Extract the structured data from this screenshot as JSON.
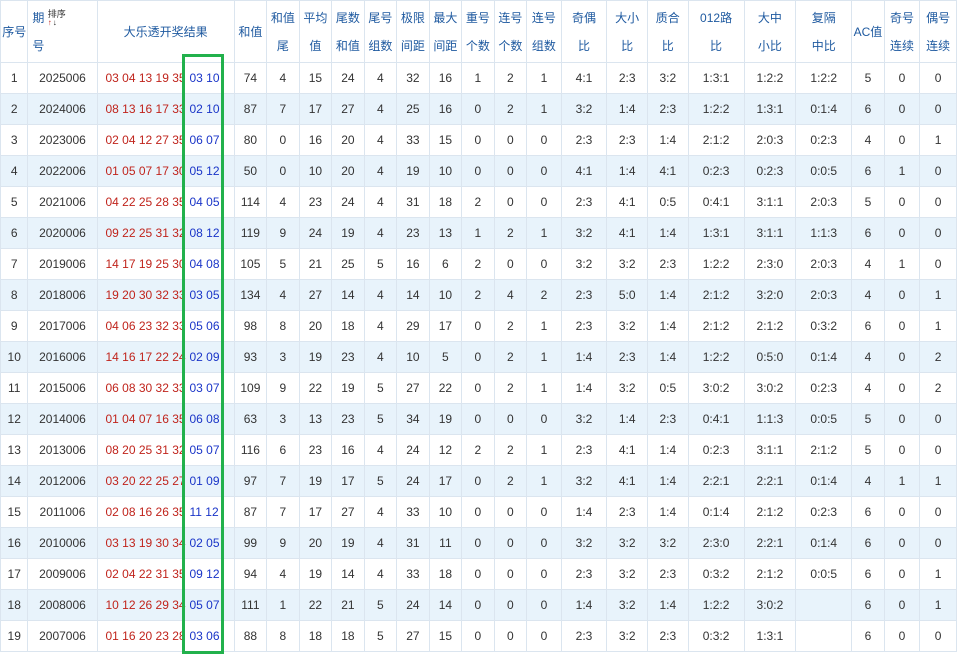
{
  "headers": {
    "seq": [
      "序号"
    ],
    "period": [
      "期",
      "号"
    ],
    "sort_label": "排序",
    "sort_up": "↑",
    "sort_down": "↓",
    "result": [
      "大乐透开奖结果"
    ],
    "cols": [
      [
        "和值"
      ],
      [
        "和值",
        "尾"
      ],
      [
        "平均",
        "值"
      ],
      [
        "尾数",
        "和值"
      ],
      [
        "尾号",
        "组数"
      ],
      [
        "极限",
        "间距"
      ],
      [
        "最大",
        "间距"
      ],
      [
        "重号",
        "个数"
      ],
      [
        "连号",
        "个数"
      ],
      [
        "连号",
        "组数"
      ],
      [
        "奇偶",
        "比"
      ],
      [
        "大小",
        "比"
      ],
      [
        "质合",
        "比"
      ],
      [
        "012路",
        "比"
      ],
      [
        "大中",
        "小比"
      ],
      [
        "复隔",
        "中比"
      ],
      [
        "AC值"
      ],
      [
        "奇号",
        "连续"
      ],
      [
        "偶号",
        "连续"
      ]
    ]
  },
  "rows": [
    {
      "seq": "1",
      "period": "2025006",
      "red": "03 04 13 19 35",
      "blue": "03 10",
      "vals": [
        "74",
        "4",
        "15",
        "24",
        "4",
        "32",
        "16",
        "1",
        "2",
        "1",
        "4:1",
        "2:3",
        "3:2",
        "1:3:1",
        "1:2:2",
        "1:2:2",
        "5",
        "0",
        "0"
      ]
    },
    {
      "seq": "2",
      "period": "2024006",
      "red": "08 13 16 17 33",
      "blue": "02 10",
      "vals": [
        "87",
        "7",
        "17",
        "27",
        "4",
        "25",
        "16",
        "0",
        "2",
        "1",
        "3:2",
        "1:4",
        "2:3",
        "1:2:2",
        "1:3:1",
        "0:1:4",
        "6",
        "0",
        "0"
      ]
    },
    {
      "seq": "3",
      "period": "2023006",
      "red": "02 04 12 27 35",
      "blue": "06 07",
      "vals": [
        "80",
        "0",
        "16",
        "20",
        "4",
        "33",
        "15",
        "0",
        "0",
        "0",
        "2:3",
        "2:3",
        "1:4",
        "2:1:2",
        "2:0:3",
        "0:2:3",
        "4",
        "0",
        "1"
      ]
    },
    {
      "seq": "4",
      "period": "2022006",
      "red": "01 05 07 17 30",
      "blue": "05 12",
      "vals": [
        "50",
        "0",
        "10",
        "20",
        "4",
        "19",
        "10",
        "0",
        "0",
        "0",
        "4:1",
        "1:4",
        "4:1",
        "0:2:3",
        "0:2:3",
        "0:0:5",
        "6",
        "1",
        "0"
      ]
    },
    {
      "seq": "5",
      "period": "2021006",
      "red": "04 22 25 28 35",
      "blue": "04 05",
      "vals": [
        "114",
        "4",
        "23",
        "24",
        "4",
        "31",
        "18",
        "2",
        "0",
        "0",
        "2:3",
        "4:1",
        "0:5",
        "0:4:1",
        "3:1:1",
        "2:0:3",
        "5",
        "0",
        "0"
      ]
    },
    {
      "seq": "6",
      "period": "2020006",
      "red": "09 22 25 31 32",
      "blue": "08 12",
      "vals": [
        "119",
        "9",
        "24",
        "19",
        "4",
        "23",
        "13",
        "1",
        "2",
        "1",
        "3:2",
        "4:1",
        "1:4",
        "1:3:1",
        "3:1:1",
        "1:1:3",
        "6",
        "0",
        "0"
      ]
    },
    {
      "seq": "7",
      "period": "2019006",
      "red": "14 17 19 25 30",
      "blue": "04 08",
      "vals": [
        "105",
        "5",
        "21",
        "25",
        "5",
        "16",
        "6",
        "2",
        "0",
        "0",
        "3:2",
        "3:2",
        "2:3",
        "1:2:2",
        "2:3:0",
        "2:0:3",
        "4",
        "1",
        "0"
      ]
    },
    {
      "seq": "8",
      "period": "2018006",
      "red": "19 20 30 32 33",
      "blue": "03 05",
      "vals": [
        "134",
        "4",
        "27",
        "14",
        "4",
        "14",
        "10",
        "2",
        "4",
        "2",
        "2:3",
        "5:0",
        "1:4",
        "2:1:2",
        "3:2:0",
        "2:0:3",
        "4",
        "0",
        "1"
      ]
    },
    {
      "seq": "9",
      "period": "2017006",
      "red": "04 06 23 32 33",
      "blue": "05 06",
      "vals": [
        "98",
        "8",
        "20",
        "18",
        "4",
        "29",
        "17",
        "0",
        "2",
        "1",
        "2:3",
        "3:2",
        "1:4",
        "2:1:2",
        "2:1:2",
        "0:3:2",
        "6",
        "0",
        "1"
      ]
    },
    {
      "seq": "10",
      "period": "2016006",
      "red": "14 16 17 22 24",
      "blue": "02 09",
      "vals": [
        "93",
        "3",
        "19",
        "23",
        "4",
        "10",
        "5",
        "0",
        "2",
        "1",
        "1:4",
        "2:3",
        "1:4",
        "1:2:2",
        "0:5:0",
        "0:1:4",
        "4",
        "0",
        "2"
      ]
    },
    {
      "seq": "11",
      "period": "2015006",
      "red": "06 08 30 32 33",
      "blue": "03 07",
      "vals": [
        "109",
        "9",
        "22",
        "19",
        "5",
        "27",
        "22",
        "0",
        "2",
        "1",
        "1:4",
        "3:2",
        "0:5",
        "3:0:2",
        "3:0:2",
        "0:2:3",
        "4",
        "0",
        "2"
      ]
    },
    {
      "seq": "12",
      "period": "2014006",
      "red": "01 04 07 16 35",
      "blue": "06 08",
      "vals": [
        "63",
        "3",
        "13",
        "23",
        "5",
        "34",
        "19",
        "0",
        "0",
        "0",
        "3:2",
        "1:4",
        "2:3",
        "0:4:1",
        "1:1:3",
        "0:0:5",
        "5",
        "0",
        "0"
      ]
    },
    {
      "seq": "13",
      "period": "2013006",
      "red": "08 20 25 31 32",
      "blue": "05 07",
      "vals": [
        "116",
        "6",
        "23",
        "16",
        "4",
        "24",
        "12",
        "2",
        "2",
        "1",
        "2:3",
        "4:1",
        "1:4",
        "0:2:3",
        "3:1:1",
        "2:1:2",
        "5",
        "0",
        "0"
      ]
    },
    {
      "seq": "14",
      "period": "2012006",
      "red": "03 20 22 25 27",
      "blue": "01 09",
      "vals": [
        "97",
        "7",
        "19",
        "17",
        "5",
        "24",
        "17",
        "0",
        "2",
        "1",
        "3:2",
        "4:1",
        "1:4",
        "2:2:1",
        "2:2:1",
        "0:1:4",
        "4",
        "1",
        "1"
      ]
    },
    {
      "seq": "15",
      "period": "2011006",
      "red": "02 08 16 26 35",
      "blue": "11 12",
      "vals": [
        "87",
        "7",
        "17",
        "27",
        "4",
        "33",
        "10",
        "0",
        "0",
        "0",
        "1:4",
        "2:3",
        "1:4",
        "0:1:4",
        "2:1:2",
        "0:2:3",
        "6",
        "0",
        "0"
      ]
    },
    {
      "seq": "16",
      "period": "2010006",
      "red": "03 13 19 30 34",
      "blue": "02 05",
      "vals": [
        "99",
        "9",
        "20",
        "19",
        "4",
        "31",
        "11",
        "0",
        "0",
        "0",
        "3:2",
        "3:2",
        "3:2",
        "2:3:0",
        "2:2:1",
        "0:1:4",
        "6",
        "0",
        "0"
      ]
    },
    {
      "seq": "17",
      "period": "2009006",
      "red": "02 04 22 31 35",
      "blue": "09 12",
      "vals": [
        "94",
        "4",
        "19",
        "14",
        "4",
        "33",
        "18",
        "0",
        "0",
        "0",
        "2:3",
        "3:2",
        "2:3",
        "0:3:2",
        "2:1:2",
        "0:0:5",
        "6",
        "0",
        "1"
      ]
    },
    {
      "seq": "18",
      "period": "2008006",
      "red": "10 12 26 29 34",
      "blue": "05 07",
      "vals": [
        "111",
        "1",
        "22",
        "21",
        "5",
        "24",
        "14",
        "0",
        "0",
        "0",
        "1:4",
        "3:2",
        "1:4",
        "1:2:2",
        "3:0:2",
        "",
        "6",
        "0",
        "1"
      ]
    },
    {
      "seq": "19",
      "period": "2007006",
      "red": "01 16 20 23 28",
      "blue": "03 06",
      "vals": [
        "88",
        "8",
        "18",
        "18",
        "5",
        "27",
        "15",
        "0",
        "0",
        "0",
        "2:3",
        "3:2",
        "2:3",
        "0:3:2",
        "1:3:1",
        "",
        "6",
        "0",
        "0"
      ]
    }
  ],
  "colors": {
    "red_ball": "#c0241c",
    "blue_ball": "#1a35c8",
    "highlight": "#22b14c",
    "header_text": "#1f5aa0",
    "stripe": "#e8f3fb"
  }
}
